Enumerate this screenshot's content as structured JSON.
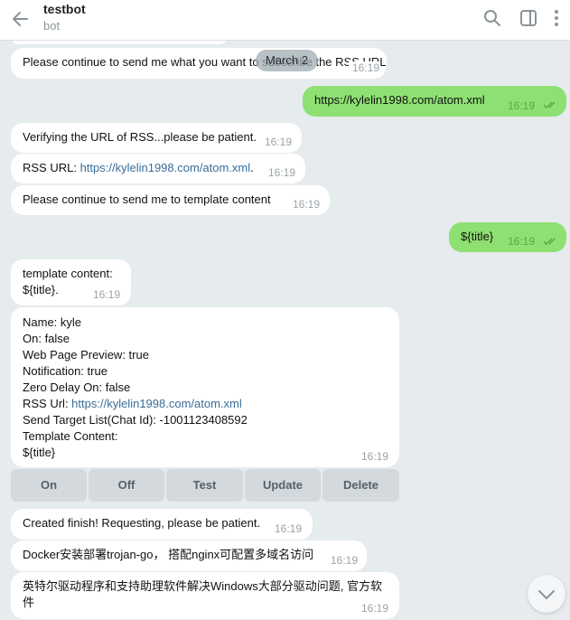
{
  "header": {
    "title": "testbot",
    "subtitle": "bot"
  },
  "date_separator": "March 2",
  "messages": [
    {
      "text": "Please continue to send me what you want to subscribe the RSS URL",
      "time": "16:19"
    },
    {
      "text": "https://kylelin1998.com/atom.xml",
      "time": "16:19"
    },
    {
      "text": "Verifying the URL of RSS...please be patient.",
      "time": "16:19"
    },
    {
      "prefix": "RSS URL: ",
      "link": "https://kylelin1998.com/atom.xml",
      "suffix": ".",
      "time": "16:19"
    },
    {
      "text": "Please continue to send me to template content",
      "time": "16:19"
    },
    {
      "text": "${title}",
      "time": "16:19"
    },
    {
      "line1": "template content:",
      "line2": "${title}.",
      "time": "16:19"
    },
    {
      "name": "Name: kyle",
      "on": "On: false",
      "preview": "Web Page Preview: true",
      "notification": "Notification: true",
      "zero_delay": "Zero Delay On: false",
      "rss_prefix": "RSS Url: ",
      "rss_link": "https://kylelin1998.com/atom.xml",
      "target": "Send Target List(Chat Id): -1001123408592",
      "template_label": "Template Content:",
      "template_value": "${title}",
      "time": "16:19"
    },
    {
      "text": "Created finish! Requesting, please be patient.",
      "time": "16:19"
    },
    {
      "text": "Docker安装部署trojan-go， 搭配nginx可配置多域名访问",
      "time": "16:19"
    },
    {
      "line1": "英特尔驱动程序和支持助理软件解决Windows大部分驱动问题, 官方软",
      "line2": "件",
      "time": "16:19"
    }
  ],
  "keyboard": {
    "on": "On",
    "off": "Off",
    "test": "Test",
    "update": "Update",
    "delete": "Delete"
  },
  "colors": {
    "outgoing_bubble": "#8ee072",
    "incoming_bubble": "#ffffff",
    "chat_background": "#e6ebee",
    "link": "#3a6d99"
  },
  "icons": [
    "back-arrow-icon",
    "search-icon",
    "sidebar-toggle-icon",
    "more-vertical-icon",
    "double-check-icon",
    "chevron-down-icon"
  ]
}
